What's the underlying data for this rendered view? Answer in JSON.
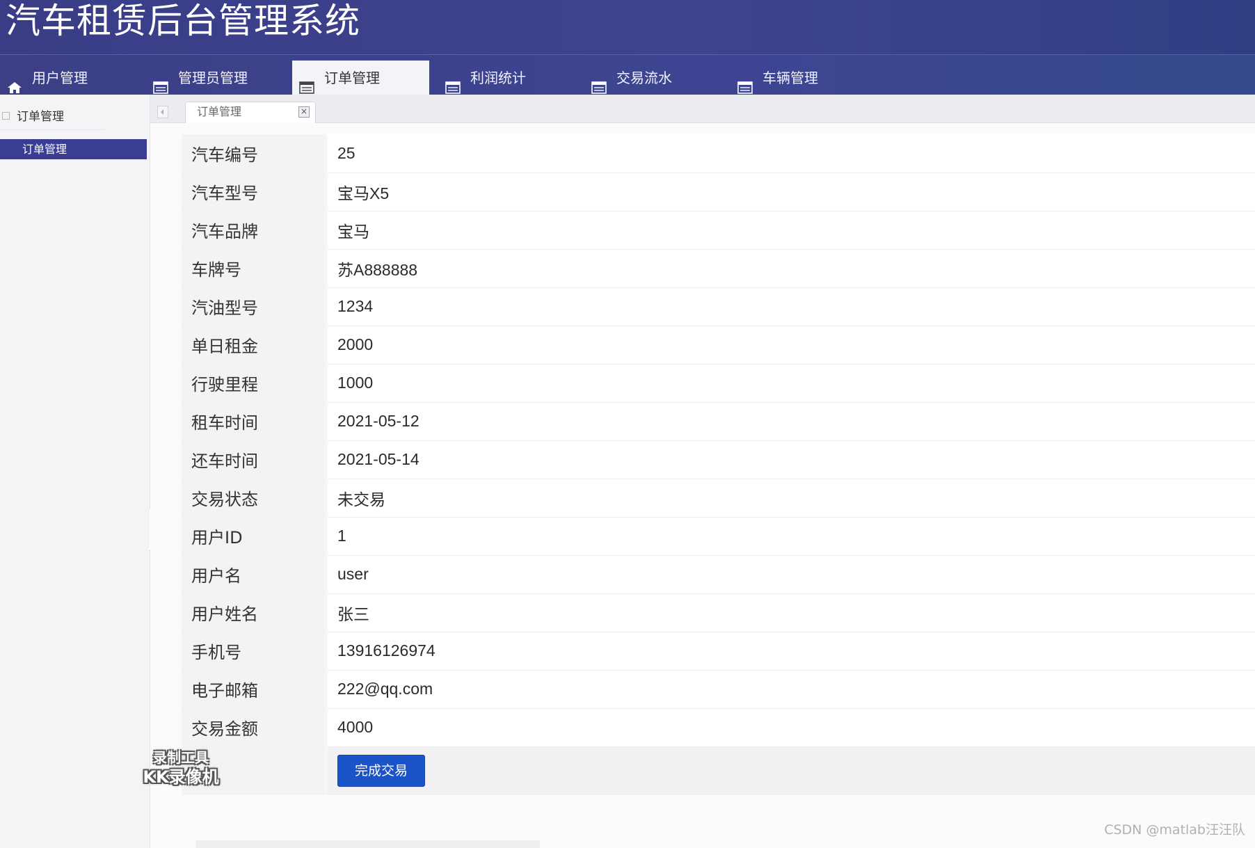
{
  "app": {
    "title": "汽车租赁后台管理系统"
  },
  "nav": {
    "items": [
      {
        "label": "用户管理",
        "icon": "home-icon"
      },
      {
        "label": "管理员管理",
        "icon": "list-icon"
      },
      {
        "label": "订单管理",
        "icon": "list-icon",
        "active": true
      },
      {
        "label": "利润统计",
        "icon": "list-icon"
      },
      {
        "label": "交易流水",
        "icon": "list-icon"
      },
      {
        "label": "车辆管理",
        "icon": "list-icon"
      }
    ]
  },
  "sidebar": {
    "header": "订单管理",
    "items": [
      {
        "label": "订单管理",
        "active": true
      }
    ]
  },
  "tabs": [
    {
      "label": "订单管理",
      "close": "×"
    }
  ],
  "form": {
    "rows": [
      {
        "label": "汽车编号",
        "value": "25"
      },
      {
        "label": "汽车型号",
        "value": "宝马X5"
      },
      {
        "label": "汽车品牌",
        "value": "宝马"
      },
      {
        "label": "车牌号",
        "value": "苏A888888"
      },
      {
        "label": "汽油型号",
        "value": "1234"
      },
      {
        "label": "单日租金",
        "value": "2000"
      },
      {
        "label": "行驶里程",
        "value": "1000"
      },
      {
        "label": "租车时间",
        "value": "2021-05-12"
      },
      {
        "label": "还车时间",
        "value": "2021-05-14"
      },
      {
        "label": "交易状态",
        "value": "未交易"
      },
      {
        "label": "用户ID",
        "value": "1"
      },
      {
        "label": "用户名",
        "value": "user"
      },
      {
        "label": "用户姓名",
        "value": "张三"
      },
      {
        "label": "手机号",
        "value": "13916126974"
      },
      {
        "label": "电子邮箱",
        "value": "222@qq.com"
      },
      {
        "label": "交易金额",
        "value": "4000"
      }
    ],
    "submit_label": "完成交易"
  },
  "overlay": {
    "tool_line1": "录制工具",
    "tool_line2": "KK录像机",
    "csdn": "CSDN @matlab汪汪队"
  },
  "colors": {
    "header_bg": "#3a3d86",
    "accent": "#3a3d91",
    "button": "#1b53c8"
  }
}
